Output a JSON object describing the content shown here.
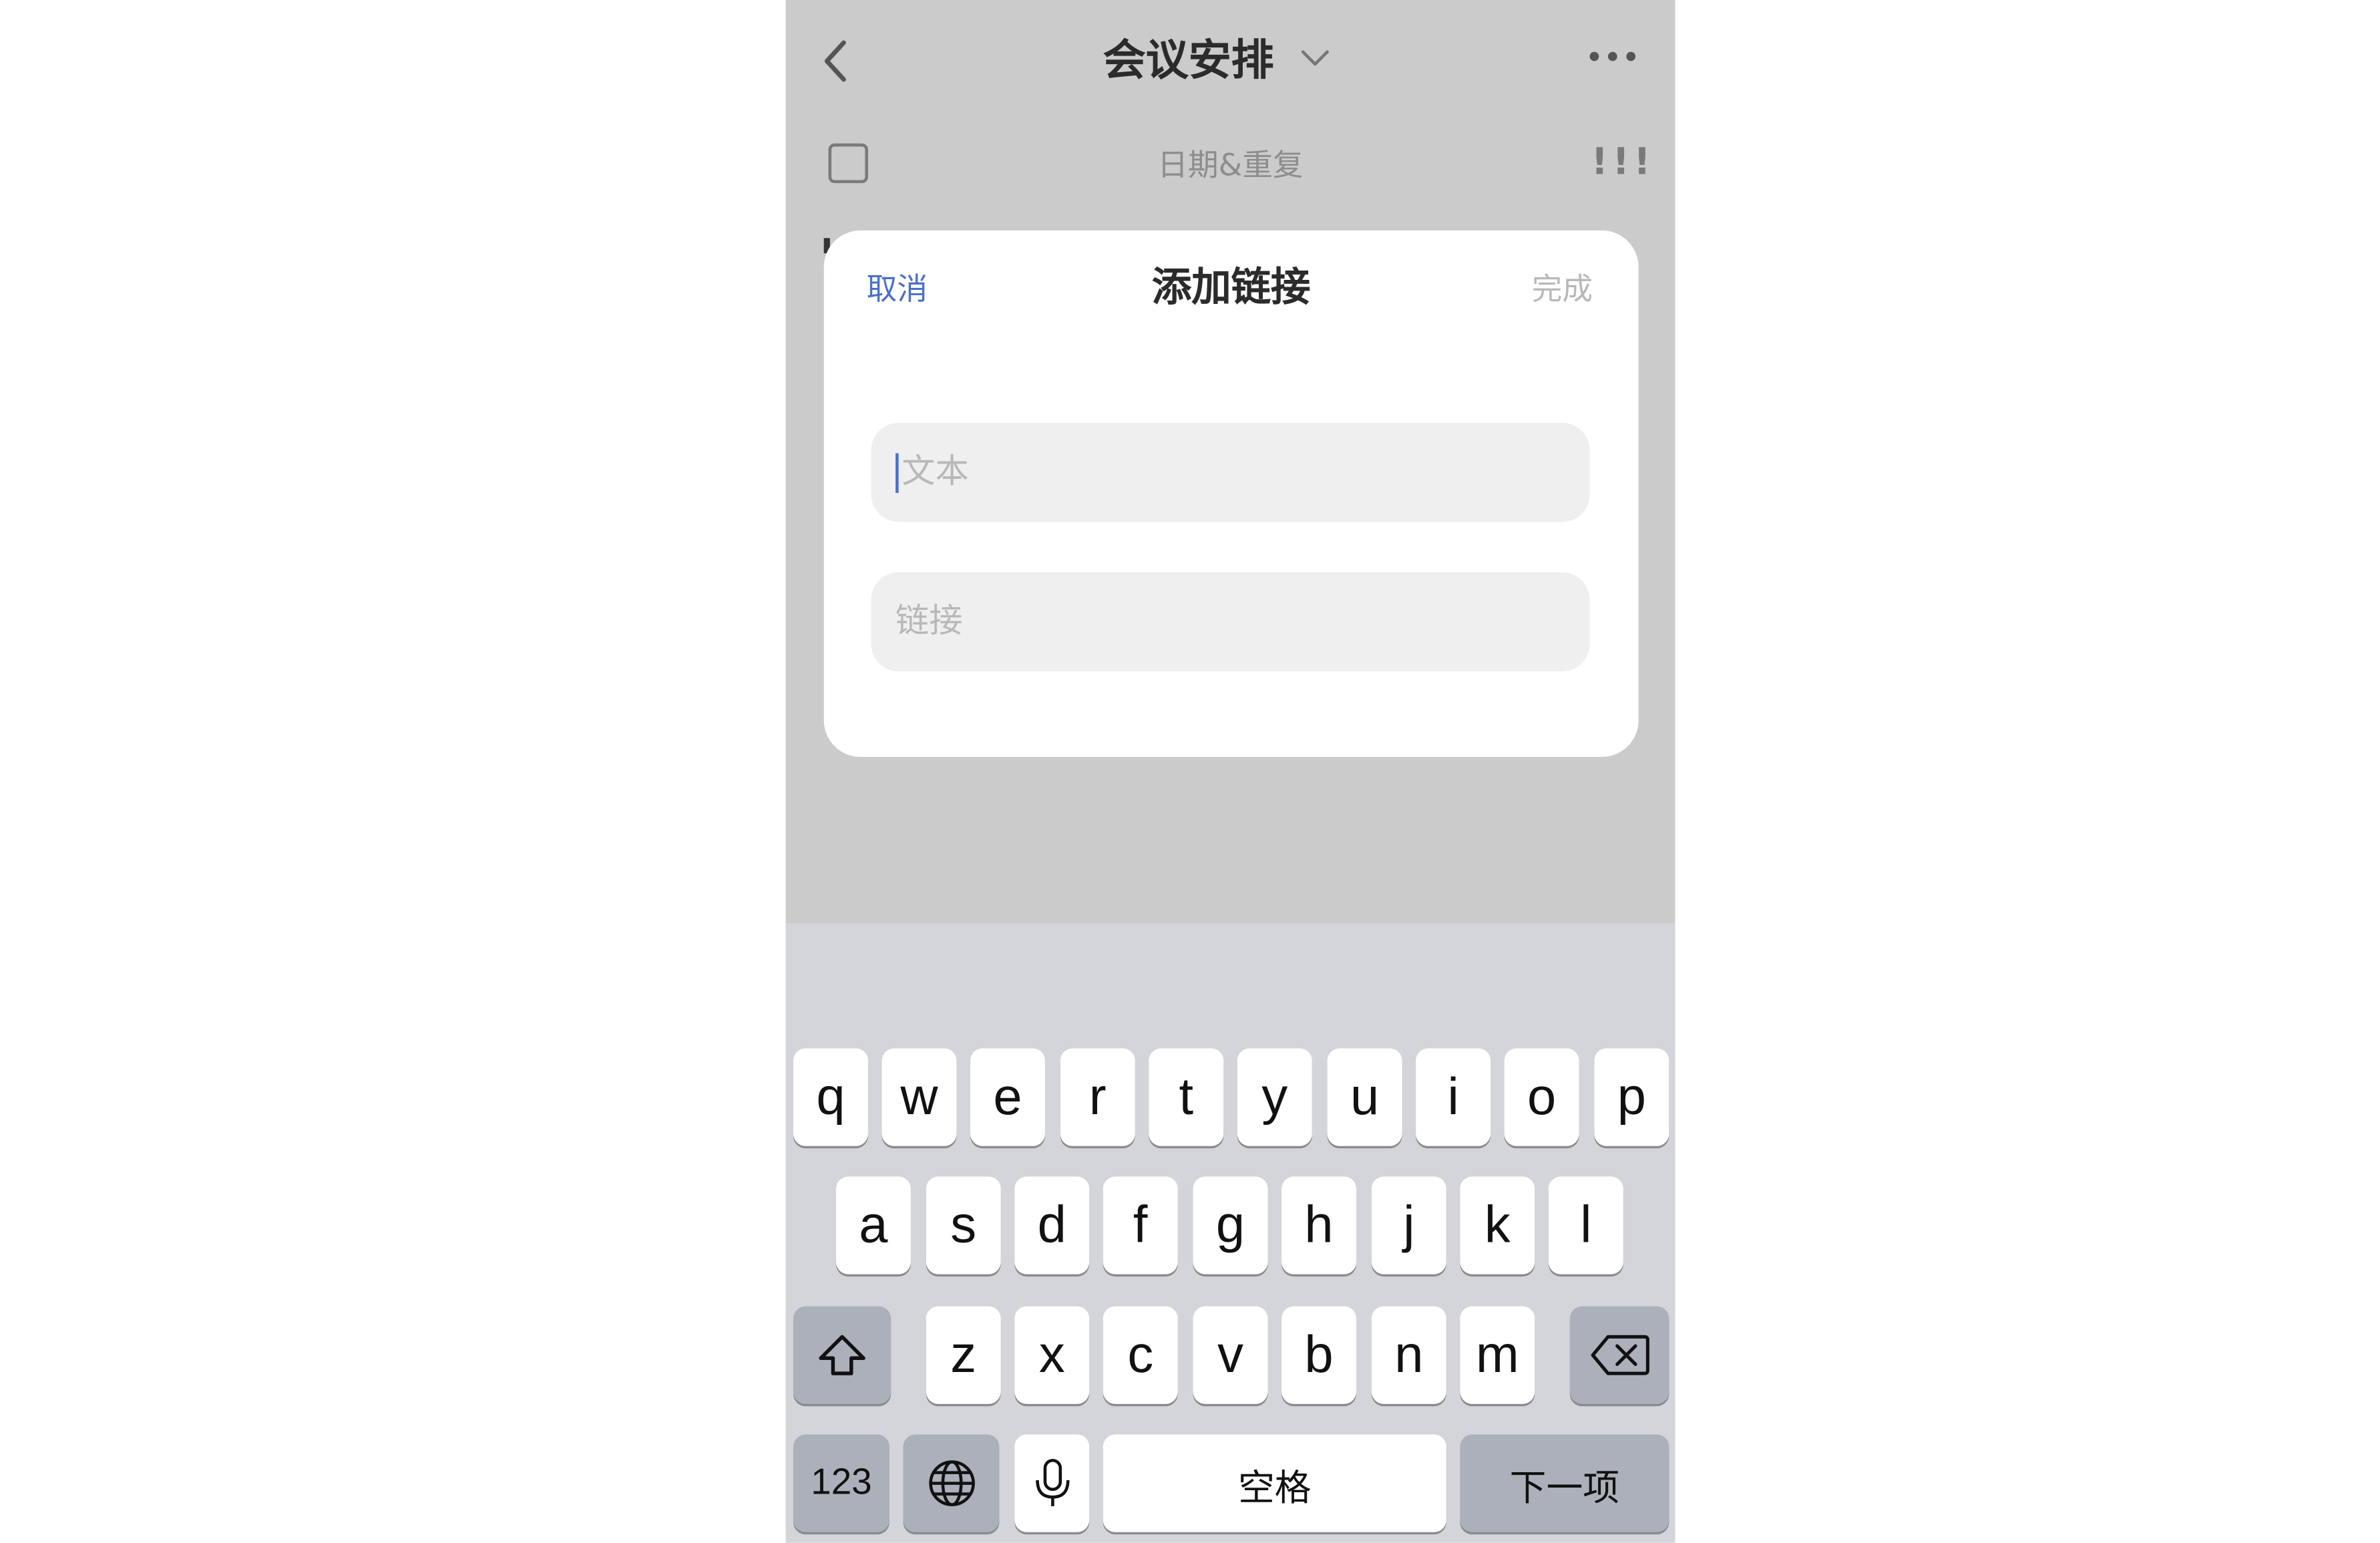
{
  "nav": {
    "title": "会议安排",
    "back_icon": "chevron-left-icon",
    "dropdown_icon": "chevron-down-icon",
    "more_icon": "more-horizontal-icon"
  },
  "task_row": {
    "date_label": "日期&重复",
    "priority_label": "!!!"
  },
  "dialog": {
    "cancel_label": "取消",
    "title": "添加链接",
    "done_label": "完成",
    "text_field": {
      "placeholder": "文本",
      "value": ""
    },
    "link_field": {
      "placeholder": "链接",
      "value": ""
    }
  },
  "keyboard": {
    "row1": [
      "q",
      "w",
      "e",
      "r",
      "t",
      "y",
      "u",
      "i",
      "o",
      "p"
    ],
    "row2": [
      "a",
      "s",
      "d",
      "f",
      "g",
      "h",
      "j",
      "k",
      "l"
    ],
    "row3": [
      "z",
      "x",
      "c",
      "v",
      "b",
      "n",
      "m"
    ],
    "numbers_label": "123",
    "space_label": "空格",
    "next_label": "下一项",
    "shift_icon": "shift-icon",
    "delete_icon": "delete-icon",
    "globe_icon": "globe-icon",
    "mic_icon": "microphone-icon"
  },
  "colors": {
    "accent": "#4a70c9",
    "overlay": "#cbcbcb",
    "keyboard_bg": "#d4d5da",
    "key_dark": "#abb0ba"
  }
}
